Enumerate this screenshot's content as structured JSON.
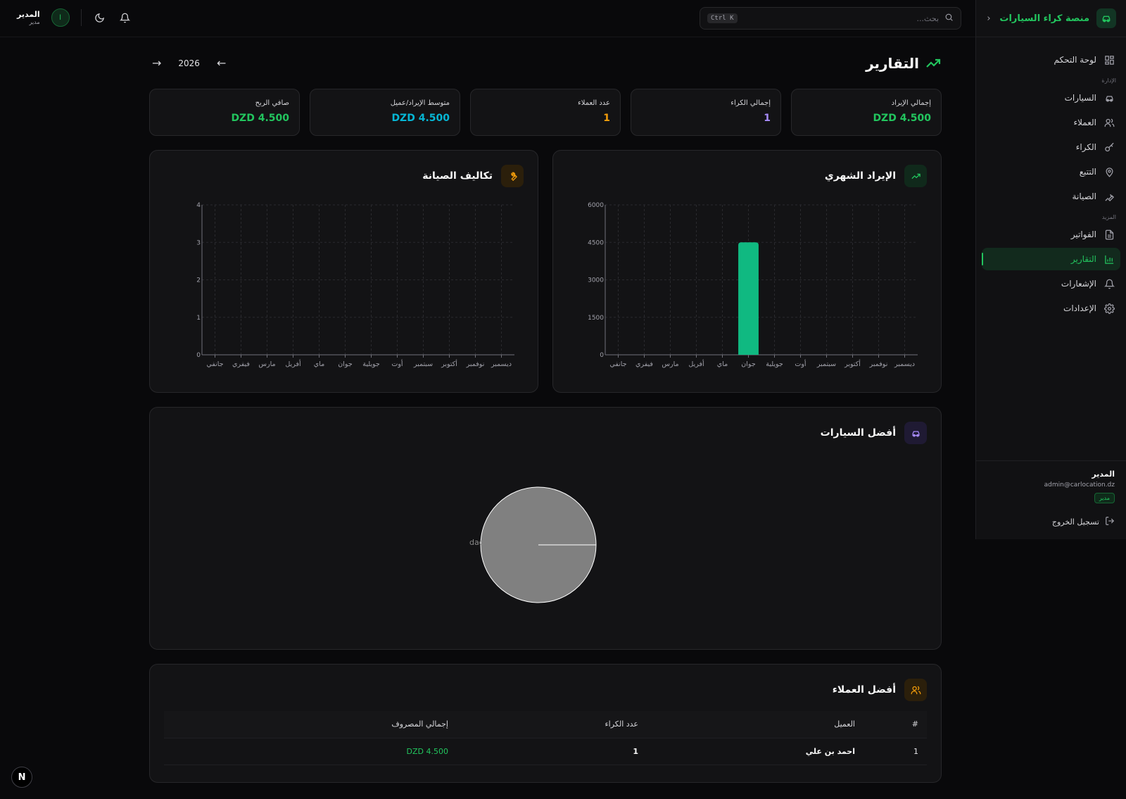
{
  "app": {
    "brand": "منصة كراء السيارات"
  },
  "sidebar": {
    "items": [
      {
        "label": "لوحة التحكم",
        "icon": "dashboard-icon"
      },
      {
        "label": "السيارات",
        "icon": "car-icon"
      },
      {
        "label": "العملاء",
        "icon": "users-icon"
      },
      {
        "label": "الكراء",
        "icon": "key-icon"
      },
      {
        "label": "التتبع",
        "icon": "map-pin-icon"
      },
      {
        "label": "الصيانة",
        "icon": "wrench-icon"
      },
      {
        "label": "الفواتير",
        "icon": "invoice-icon"
      },
      {
        "label": "التقارير",
        "icon": "bar-chart-icon",
        "active": true
      },
      {
        "label": "الإشعارات",
        "icon": "bell-icon"
      },
      {
        "label": "الإعدادات",
        "icon": "gear-icon"
      }
    ],
    "section_admin": "الإدارة",
    "section_more": "المزيد",
    "user": {
      "name": "المدير",
      "email": "admin@carlocation.dz",
      "role": "مدير"
    },
    "logout": "تسجيل الخروج"
  },
  "topbar": {
    "search_placeholder": "بحث...",
    "shortcut": "Ctrl K",
    "user_name": "المدير",
    "user_role": "مدير",
    "avatar_letter": "ا"
  },
  "page": {
    "title": "التقارير",
    "year": "2026"
  },
  "stats": [
    {
      "label": "إجمالي الإيراد",
      "value": "DZD 4.500",
      "color": "#22c55e"
    },
    {
      "label": "إجمالي الكراء",
      "value": "1",
      "color": "#a78bfa"
    },
    {
      "label": "عدد العملاء",
      "value": "1",
      "color": "#f59e0b"
    },
    {
      "label": "متوسط الإيراد/عميل",
      "value": "DZD 4.500",
      "color": "#06b6d4"
    },
    {
      "label": "صافي الربح",
      "value": "DZD 4.500",
      "color": "#22c55e"
    }
  ],
  "chart_data": [
    {
      "type": "bar",
      "title": "الإيراد الشهري",
      "categories": [
        "جانفي",
        "فيفري",
        "مارس",
        "أفريل",
        "ماي",
        "جوان",
        "جويلية",
        "أوت",
        "سبتمبر",
        "أكتوبر",
        "نوفمبر",
        "ديسمبر"
      ],
      "values": [
        0,
        0,
        0,
        0,
        0,
        4500,
        0,
        0,
        0,
        0,
        0,
        0
      ],
      "yticks": [
        "0",
        "1500",
        "3000",
        "4500",
        "6000"
      ],
      "ylim": [
        0,
        6000
      ],
      "color": "#10b981",
      "grid": true
    },
    {
      "type": "bar",
      "title": "تكاليف الصيانة",
      "categories": [
        "جانفي",
        "فيفري",
        "مارس",
        "أفريل",
        "ماي",
        "جوان",
        "جويلية",
        "أوت",
        "سبتمبر",
        "أكتوبر",
        "نوفمبر",
        "ديسمبر"
      ],
      "values": [
        0,
        0,
        0,
        0,
        0,
        0,
        0,
        0,
        0,
        0,
        0,
        0
      ],
      "yticks": [
        "0",
        "1",
        "2",
        "3",
        "4"
      ],
      "ylim": [
        0,
        4
      ],
      "color": "#f59e0b",
      "grid": true
    },
    {
      "type": "pie",
      "title": "أفضل السيارات",
      "slices": [
        {
          "label": "dac",
          "value": 1
        }
      ],
      "color": "#808080"
    }
  ],
  "top_clients": {
    "title": "أفضل العملاء",
    "columns": [
      "#",
      "العميل",
      "عدد الكراء",
      "إجمالي المصروف"
    ],
    "rows": [
      {
        "rank": "1",
        "name": "احمد بن علي",
        "rentals": "1",
        "total": "DZD 4.500"
      }
    ]
  }
}
